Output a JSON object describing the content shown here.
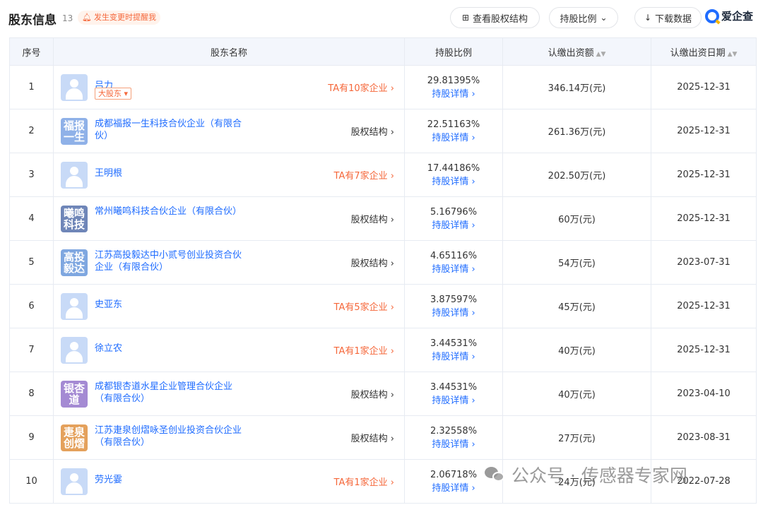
{
  "header": {
    "title": "股东信息",
    "count": "13",
    "remind": "发生变更时提醒我",
    "btn_structure": "查看股权结构",
    "btn_ratio": "持股比例",
    "btn_download": "下载数据",
    "logo": "爱企查"
  },
  "table": {
    "headers": {
      "idx": "序号",
      "name": "股东名称",
      "ratio": "持股比例",
      "amount": "认缴出资额",
      "date": "认缴出资日期"
    },
    "detail_label": "持股详情",
    "rows": [
      {
        "idx": "1",
        "name": "吕力",
        "tag": "大股东",
        "link": "TA有10家企业",
        "ratio": "29.81395%",
        "amount": "346.14万(元)",
        "date": "2025-12-31"
      },
      {
        "idx": "2",
        "name": "成都福报一生科技合伙企业（有限合伙）",
        "avatar_text": "福报一生",
        "avatar_color": "#8fb1e8",
        "link": "股权结构",
        "ratio": "22.51163%",
        "amount": "261.36万(元)",
        "date": "2025-12-31"
      },
      {
        "idx": "3",
        "name": "王明根",
        "link": "TA有7家企业",
        "ratio": "17.44186%",
        "amount": "202.50万(元)",
        "date": "2025-12-31"
      },
      {
        "idx": "4",
        "name": "常州曦鸣科技合伙企业（有限合伙）",
        "avatar_text": "曦鸣科技",
        "avatar_color": "#6f86b8",
        "link": "股权结构",
        "ratio": "5.16796%",
        "amount": "60万(元)",
        "date": "2025-12-31"
      },
      {
        "idx": "5",
        "name": "江苏高投毅达中小贰号创业投资合伙企业（有限合伙）",
        "avatar_text": "高投毅达",
        "avatar_color": "#7fa7e0",
        "link": "股权结构",
        "ratio": "4.65116%",
        "amount": "54万(元)",
        "date": "2023-07-31"
      },
      {
        "idx": "6",
        "name": "史亚东",
        "link": "TA有5家企业",
        "ratio": "3.87597%",
        "amount": "45万(元)",
        "date": "2025-12-31"
      },
      {
        "idx": "7",
        "name": "徐立农",
        "link": "TA有1家企业",
        "ratio": "3.44531%",
        "amount": "40万(元)",
        "date": "2025-12-31"
      },
      {
        "idx": "8",
        "name": "成都银杏道水星企业管理合伙企业（有限合伙）",
        "avatar_text": "银杏道",
        "avatar_color": "#a48ad3",
        "link": "股权结构",
        "ratio": "3.44531%",
        "amount": "40万(元)",
        "date": "2023-04-10"
      },
      {
        "idx": "9",
        "name": "江苏疌泉创熠咏圣创业投资合伙企业（有限合伙）",
        "avatar_text": "疌泉创熠",
        "avatar_color": "#e4a15c",
        "link": "股权结构",
        "ratio": "2.32558%",
        "amount": "27万(元)",
        "date": "2023-08-31"
      },
      {
        "idx": "10",
        "name": "劳光霎",
        "link": "TA有1家企业",
        "ratio": "2.06718%",
        "amount": "24万(元)",
        "date": "2022-07-28"
      }
    ]
  },
  "watermark": "公众号 · 传感器专家网"
}
